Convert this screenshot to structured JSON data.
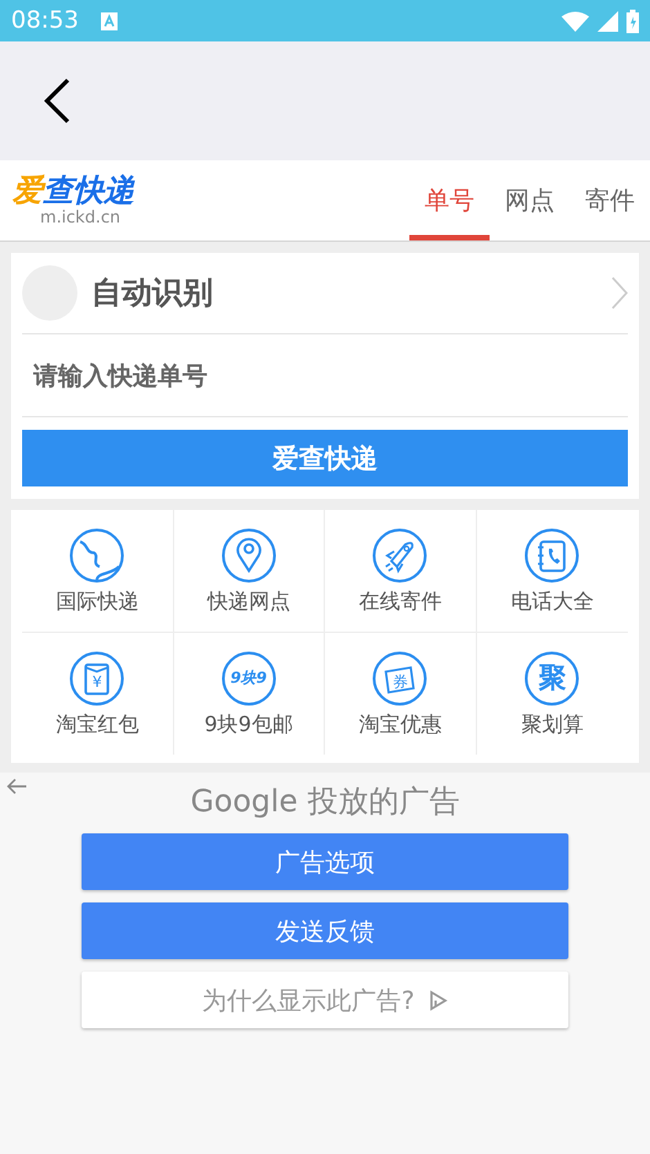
{
  "status_bar": {
    "time": "08:53"
  },
  "header": {
    "logo": {
      "accent": "爱",
      "name": "查快递",
      "domain": "m.ickd.cn"
    },
    "tabs": [
      {
        "label": "单号",
        "selected": true
      },
      {
        "label": "网点",
        "selected": false
      },
      {
        "label": "寄件",
        "selected": false
      }
    ]
  },
  "query": {
    "mode": "自动识别",
    "input": {
      "placeholder": "请输入快递单号"
    },
    "button": "爱查快递"
  },
  "services": [
    {
      "kind": "globe",
      "label": "国际快递"
    },
    {
      "kind": "pin",
      "label": "快递网点"
    },
    {
      "kind": "rocket",
      "label": "在线寄件"
    },
    {
      "kind": "phonebook",
      "label": "电话大全"
    },
    {
      "kind": "envelope",
      "icon_text": "¥",
      "label": "淘宝红包"
    },
    {
      "kind": "text",
      "icon_text": "9块9",
      "label": "9块9包邮"
    },
    {
      "kind": "ticket",
      "icon_text": "券",
      "label": "淘宝优惠"
    },
    {
      "kind": "text",
      "icon_text": "聚",
      "label": "聚划算"
    }
  ],
  "ad": {
    "title": "Google 投放的广告",
    "buttons": [
      {
        "kind": "primary",
        "label": "广告选项"
      },
      {
        "kind": "primary",
        "label": "发送反馈"
      },
      {
        "kind": "secondary",
        "label": "为什么显示此广告?"
      }
    ]
  }
}
